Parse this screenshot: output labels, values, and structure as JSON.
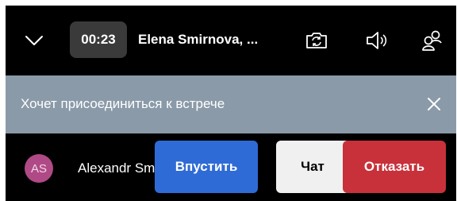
{
  "call": {
    "timer": "00:23",
    "title": "Elena Smirnova, ..."
  },
  "icons": {
    "collapse": "chevron-down-icon",
    "camera": "camera-switch-icon",
    "speaker": "speaker-icon",
    "participants": "participants-icon",
    "close": "close-icon"
  },
  "banner": {
    "text": "Хочет присоединиться к встрече"
  },
  "lobby": {
    "avatar_initials": "AS",
    "name": "Alexandr Smirnov",
    "admit_label": "Впустить",
    "chat_label": "Чат",
    "decline_label": "Отказать"
  },
  "colors": {
    "background": "#000000",
    "timer_bg": "#3a3a3a",
    "banner_bg": "#8a9aa8",
    "avatar_bg": "#b04a86",
    "admit": "#2f6bd6",
    "chat": "#f0f0f0",
    "decline": "#c8313a"
  }
}
